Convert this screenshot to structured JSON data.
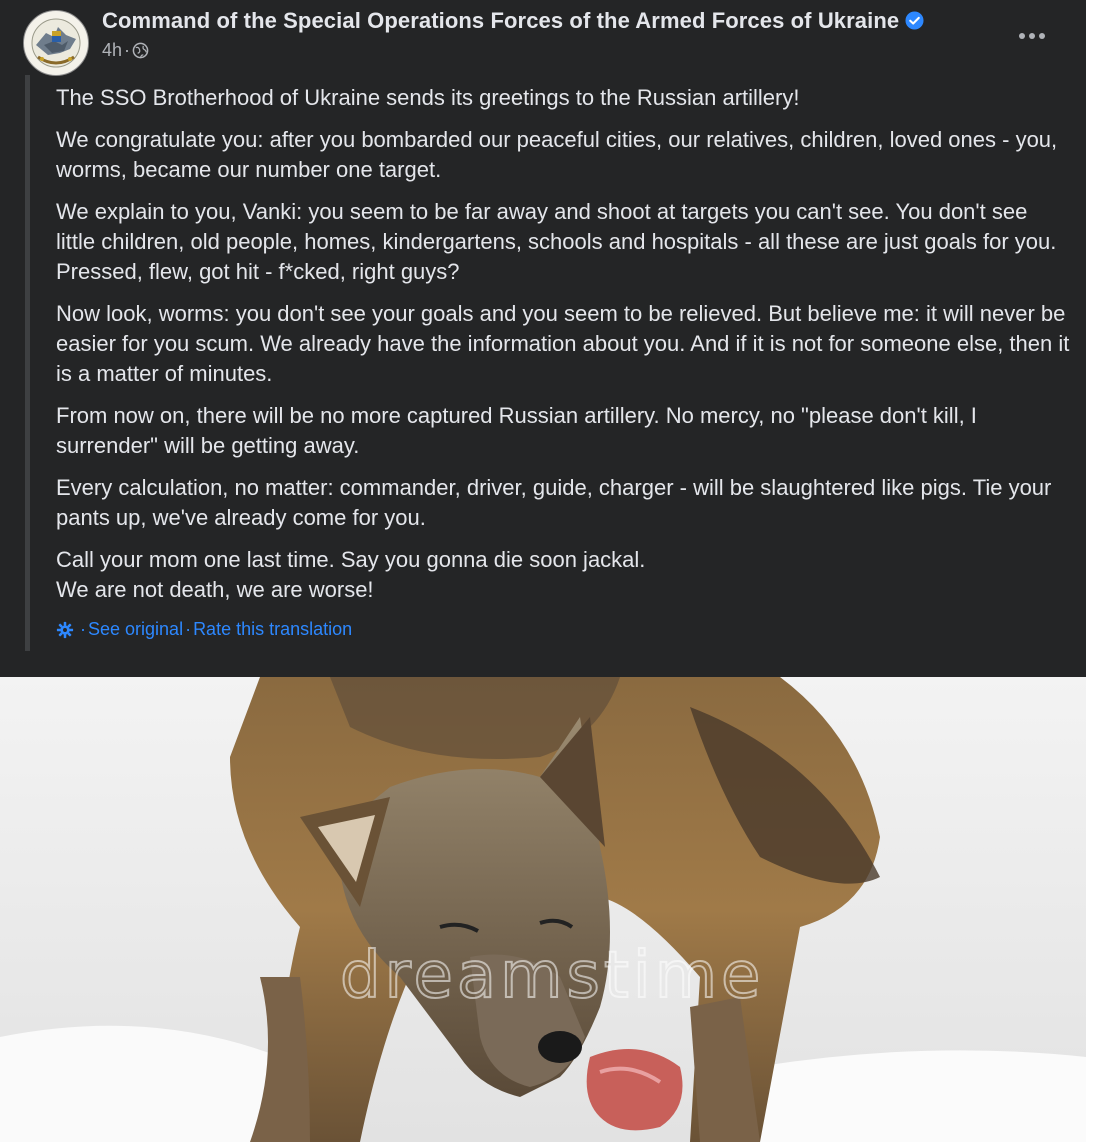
{
  "post": {
    "page_name": "Command of the Special Operations Forces of the Armed Forces of Ukraine",
    "time": "4h",
    "time_separator": "·",
    "privacy_icon": "globe-icon",
    "verified_icon": "verified-badge-icon",
    "more_icon": "more-options-icon",
    "paragraphs": [
      "The SSO Brotherhood of Ukraine sends its greetings to the Russian artillery!",
      "We congratulate you: after you bombarded our peaceful cities, our relatives, children, loved ones - you, worms, became our number one target.",
      "We explain to you, Vanki: you seem to be far away and shoot at targets you can't see. You don't see little children, old people, homes, kindergartens, schools and hospitals - all these are just goals for you. Pressed, flew, got hit - f*cked, right guys?",
      "Now look, worms: you don't see your goals and you seem to be relieved. But believe me: it will never be easier for you scum. We already have the information about you. And if it is not for someone else, then it is a matter of minutes.",
      "From now on, there will be no more captured Russian artillery. No mercy, no \"please don't kill, I surrender\" will be getting away.",
      "Every calculation, no matter: commander, driver, guide, charger - will be slaughtered like pigs. Tie your pants up, we've already come for you.",
      "Call your mom one last time. Say you gonna die soon jackal.\nWe are not death, we are worse!"
    ],
    "translation": {
      "icon": "gear-icon",
      "see_original": "See original",
      "separator": "·",
      "rate": "Rate this translation"
    },
    "image": {
      "watermark": "dreamstime"
    }
  },
  "colors": {
    "card_bg": "#242526",
    "text_primary": "#e4e6eb",
    "text_secondary": "#b0b3b8",
    "link": "#2d88ff",
    "verified": "#2d88ff"
  }
}
